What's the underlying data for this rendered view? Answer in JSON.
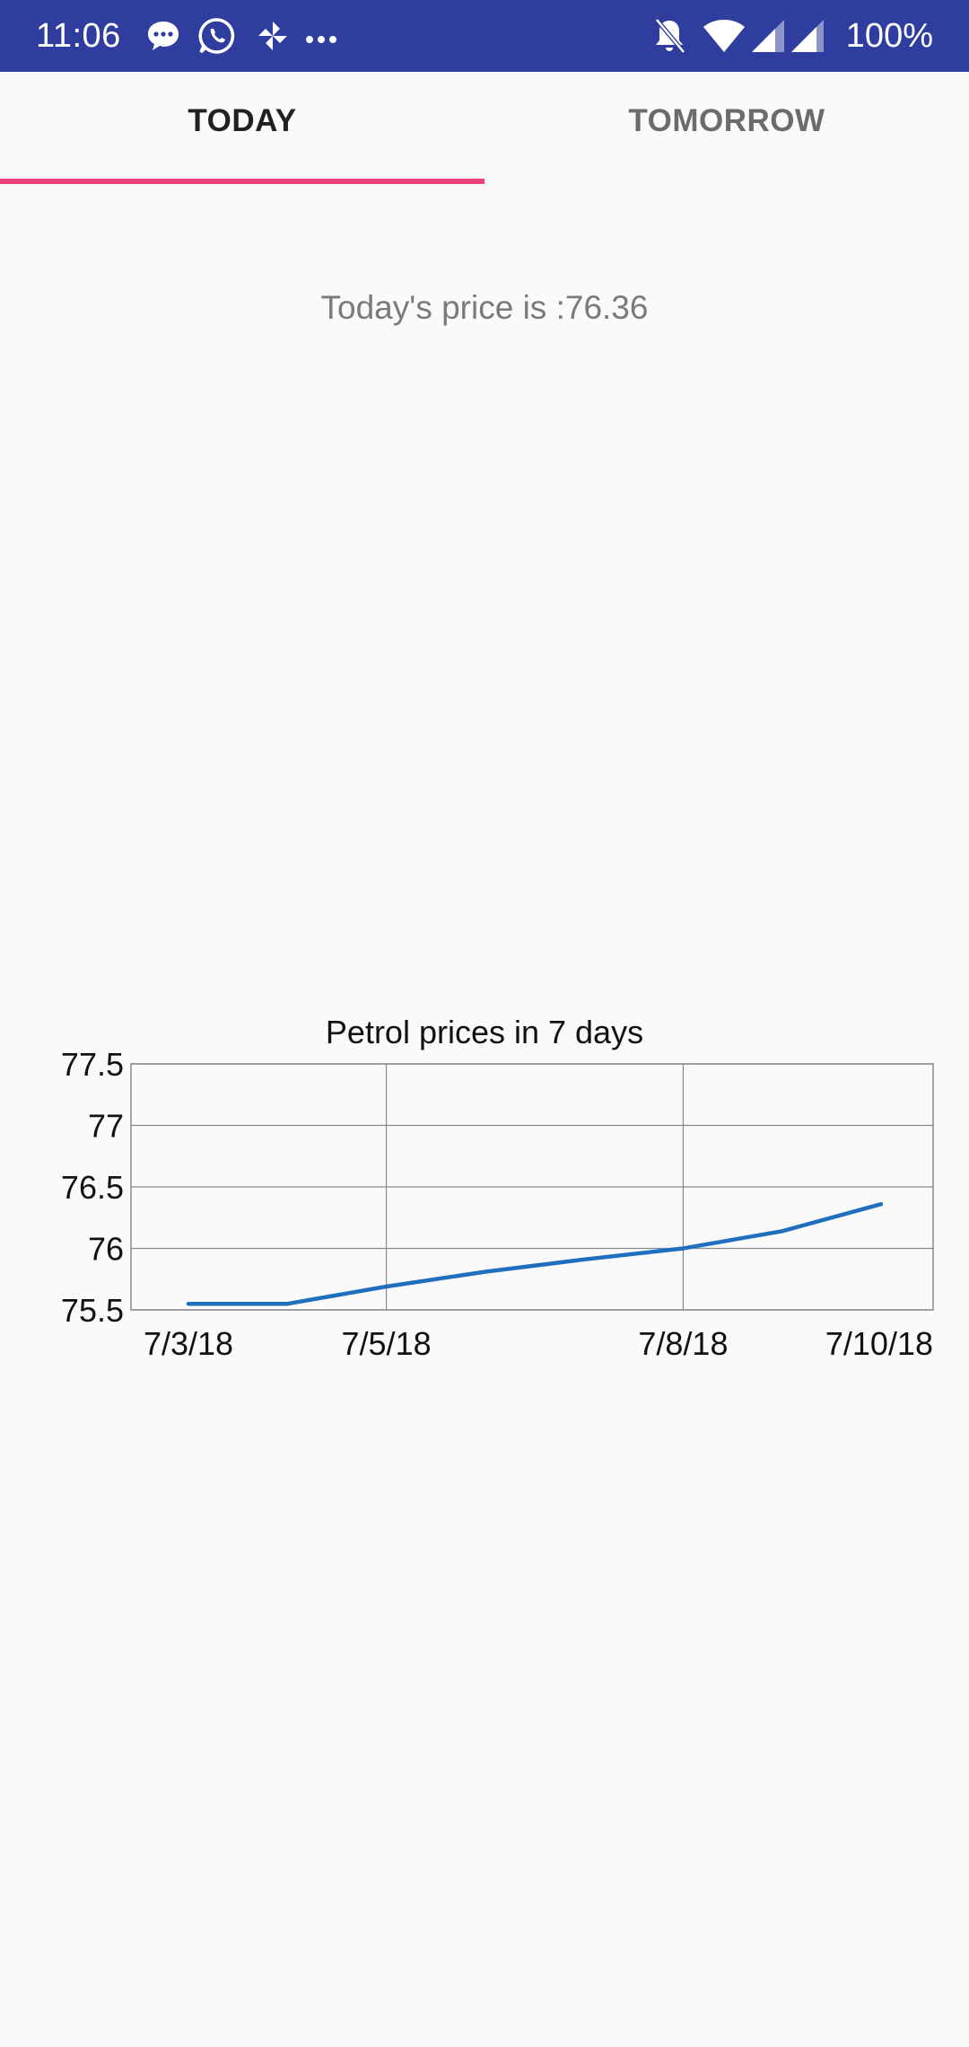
{
  "status_bar": {
    "time": "11:06",
    "battery": "100%",
    "icons": [
      "message-notification-icon",
      "whatsapp-icon",
      "pinwheel-app-icon",
      "more-notifications-icon",
      "notifications-muted-icon",
      "wifi-icon",
      "cell-signal-icon",
      "cell-signal-icon"
    ]
  },
  "tabs": {
    "today_label": "TODAY",
    "tomorrow_label": "TOMORROW",
    "selected": "TODAY",
    "indicator_color": "#ec407a"
  },
  "main": {
    "price_text": "Today's price is :76.36"
  },
  "chart_data": {
    "type": "line",
    "title": "Petrol prices in 7 days",
    "xlabel": "",
    "ylabel": "",
    "x": [
      "7/3/18",
      "7/4/18",
      "7/5/18",
      "7/6/18",
      "7/7/18",
      "7/8/18",
      "7/9/18",
      "7/10/18"
    ],
    "x_tick_labels": [
      "7/3/18",
      "7/5/18",
      "7/8/18",
      "7/10/18"
    ],
    "y_tick_labels": [
      "77.5",
      "77",
      "76.5",
      "76",
      "75.5"
    ],
    "series": [
      {
        "values": [
          75.55,
          75.55,
          75.69,
          75.81,
          75.91,
          76.0,
          76.14,
          76.36
        ],
        "color": "#1f6fbf"
      }
    ],
    "ylim": [
      75.5,
      77.5
    ],
    "grid": true,
    "legend": "none"
  }
}
